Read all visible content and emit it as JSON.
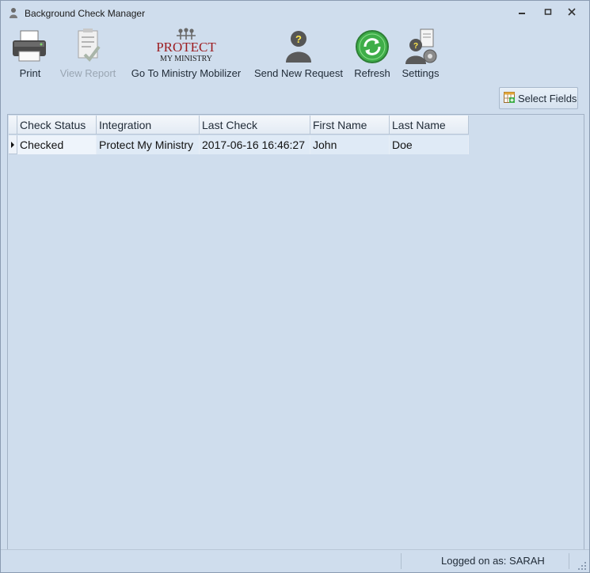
{
  "window": {
    "title": "Background Check Manager",
    "minimize_icon": "minimize-icon",
    "restore_icon": "restore-icon",
    "close_icon": "close-icon"
  },
  "toolbar": {
    "items": [
      {
        "label": "Print",
        "icon": "printer-icon",
        "enabled": true
      },
      {
        "label": "View Report",
        "icon": "clipboard-report-icon",
        "enabled": false
      },
      {
        "label": "Go To Ministry Mobilizer",
        "icon": "protect-my-ministry-logo",
        "enabled": true
      },
      {
        "label": "Send New Request",
        "icon": "unknown-person-icon",
        "enabled": true
      },
      {
        "label": "Refresh",
        "icon": "refresh-icon",
        "enabled": true
      },
      {
        "label": "Settings",
        "icon": "settings-person-icon",
        "enabled": true
      }
    ],
    "logo_text_1": "PROTECT",
    "logo_text_2": "MY MINISTRY"
  },
  "select_fields": {
    "label": "Select Fields",
    "icon": "table-add-icon"
  },
  "grid": {
    "columns": [
      "Check Status",
      "Integration",
      "Last Check",
      "First Name",
      "Last Name"
    ],
    "rows": [
      [
        "Checked",
        "Protect My Ministry",
        "2017-06-16 16:46:27",
        "John",
        "Doe"
      ]
    ]
  },
  "status": {
    "logged_on": "Logged on as: SARAH"
  },
  "colors": {
    "background": "#cfdded",
    "row_highlight": "#dfeaf6",
    "refresh_green": "#3fae49",
    "logo_red": "#9c1b1f"
  }
}
